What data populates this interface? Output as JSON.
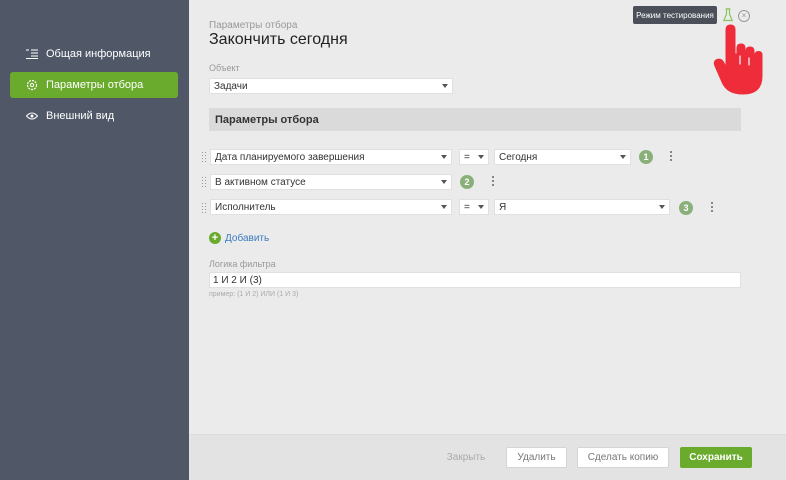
{
  "sidebar": {
    "items": [
      {
        "label": "Общая информация",
        "icon": "list-icon",
        "active": false
      },
      {
        "label": "Параметры отбора",
        "icon": "gear-icon",
        "active": true
      },
      {
        "label": "Внешний вид",
        "icon": "eye-icon",
        "active": false
      }
    ]
  },
  "header": {
    "subtitle": "Параметры отбора",
    "title": "Закончить сегодня"
  },
  "object": {
    "label": "Объект",
    "value": "Задачи"
  },
  "filters": {
    "section_title": "Параметры отбора",
    "rows": [
      {
        "field": "Дата планируемого завершения",
        "operator": "=",
        "value": "Сегодня",
        "index": "1"
      },
      {
        "field": "В активном статусе",
        "index": "2"
      },
      {
        "field": "Исполнитель",
        "operator": "=",
        "value": "Я",
        "index": "3"
      }
    ],
    "add_label": "Добавить"
  },
  "logic": {
    "label": "Логика фильтра",
    "value": "1 И 2 И (3)",
    "hint": "пример: (1 И 2) ИЛИ (1 И 3)"
  },
  "footer": {
    "close": "Закрыть",
    "delete": "Удалить",
    "copy": "Сделать копию",
    "save": "Сохранить"
  },
  "test_mode": {
    "label": "Режим тестирования"
  },
  "colors": {
    "accent": "#6aab2e",
    "sidebar": "#505868",
    "link": "#3a7cc1"
  }
}
